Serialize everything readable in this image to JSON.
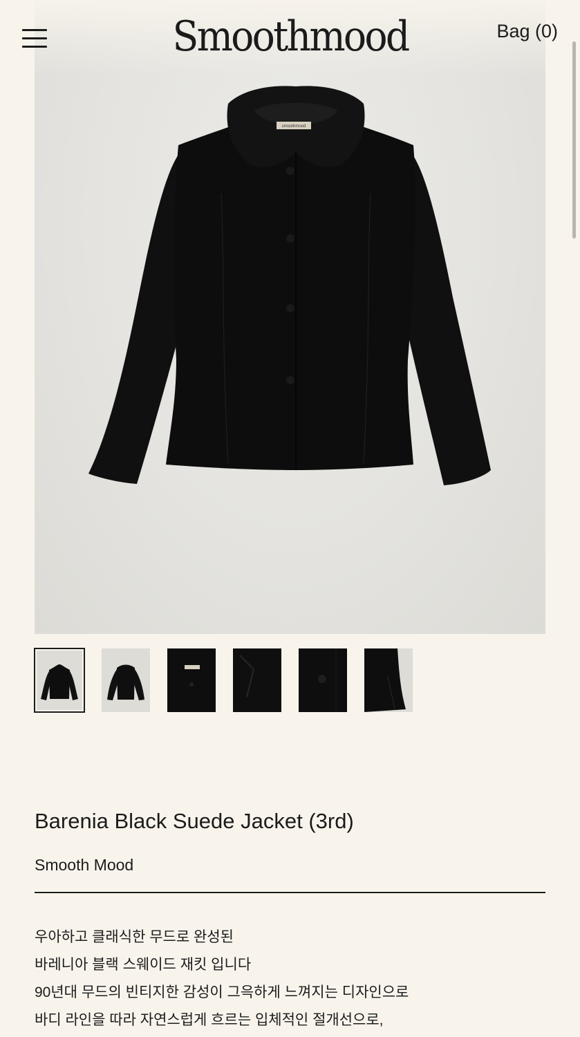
{
  "header": {
    "logo_text": "Smoothmood",
    "bag_label": "Bag (0)",
    "menu_icon": "hamburger-menu-icon"
  },
  "gallery": {
    "thumbnails": [
      {
        "label": "full-front",
        "active": true
      },
      {
        "label": "full-side",
        "active": false
      },
      {
        "label": "collar-detail",
        "active": false
      },
      {
        "label": "inner-detail",
        "active": false
      },
      {
        "label": "button-detail",
        "active": false
      },
      {
        "label": "hem-detail",
        "active": false
      }
    ]
  },
  "product": {
    "title": "Barenia Black Suede Jacket (3rd)",
    "brand": "Smooth Mood",
    "label_text": "smoothmood",
    "description": [
      "우아하고 클래식한 무드로 완성된",
      "바레니아 블랙 스웨이드 재킷 입니다",
      "90년대 무드의 빈티지한 감성이 그윽하게 느껴지는 디자인으로",
      "바디 라인을 따라 자연스럽게 흐르는 입체적인 절개선으로,"
    ]
  }
}
